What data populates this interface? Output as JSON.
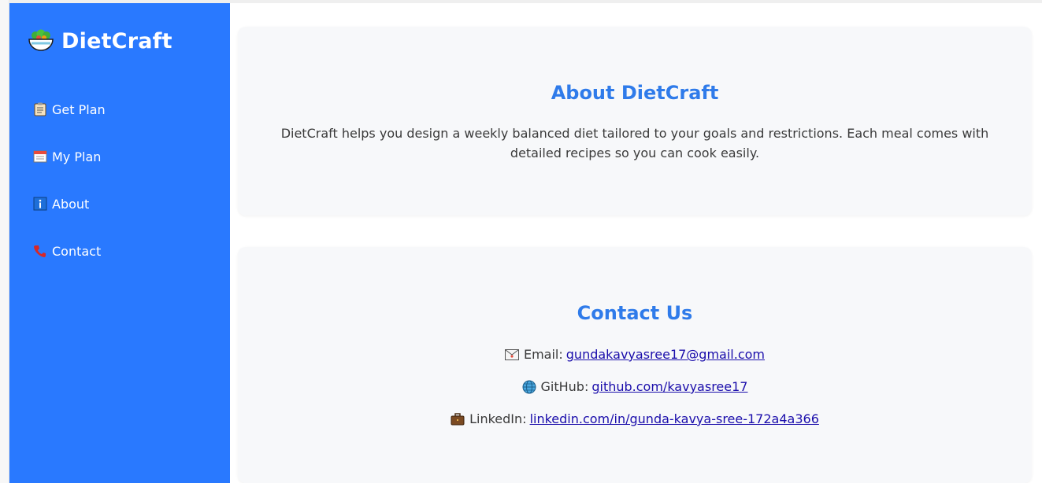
{
  "brand": {
    "title": "DietCraft",
    "icon": "salad-bowl-icon"
  },
  "sidebar": {
    "items": [
      {
        "label": "Get Plan",
        "icon": "clipboard-icon"
      },
      {
        "label": "My Plan",
        "icon": "calendar-icon"
      },
      {
        "label": "About",
        "icon": "info-icon"
      },
      {
        "label": "Contact",
        "icon": "phone-icon"
      }
    ]
  },
  "about": {
    "title": "About DietCraft",
    "text": "DietCraft helps you design a weekly balanced diet tailored to your goals and restrictions. Each meal comes with detailed recipes so you can cook easily."
  },
  "contact": {
    "title": "Contact Us",
    "email_label": "Email:",
    "email_value": "gundakavyasree17@gmail.com",
    "github_label": "GitHub:",
    "github_value": "github.com/kavyasree17",
    "linkedin_label": "LinkedIn:",
    "linkedin_value": "linkedin.com/in/gunda-kavya-sree-172a4a366"
  },
  "colors": {
    "sidebar": "#2979ff",
    "accent": "#2f7bea",
    "link": "#1a0dab"
  }
}
